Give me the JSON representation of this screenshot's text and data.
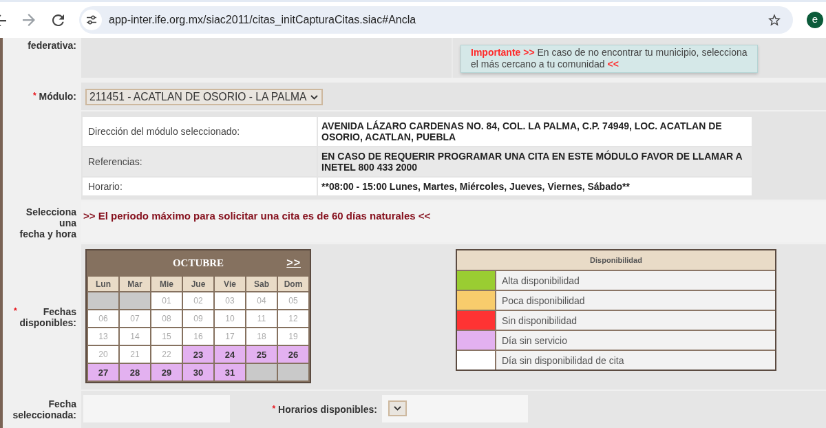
{
  "browser": {
    "url": "app-inter.ife.org.mx/siac2011/citas_initCapturaCitas.siac#Ancla",
    "profile_initial": "e"
  },
  "entity_row": {
    "label": "federativa:",
    "notice": "**Importante >>** En caso de no encontrar tu municipio, selecciona el más cercano a tu comunidad **<<**"
  },
  "module_row": {
    "required_mark": "*",
    "label": "Módulo:",
    "value": "211451 - ACATLAN DE OSORIO - LA PALMA"
  },
  "module_details": [
    {
      "label": "Dirección del módulo seleccionado:",
      "value": "AVENIDA LÁZARO CARDENAS NO. 84, COL. LA PALMA, C.P. 74949, LOC. ACATLAN DE OSORIO, ACATLAN, PUEBLA"
    },
    {
      "label": "Referencias:",
      "value": "EN CASO DE REQUERIR PROGRAMAR UNA CITA EN ESTE MÓDULO FAVOR DE LLAMAR A INETEL 800 433 2000"
    },
    {
      "label": "Horario:",
      "value": "**08:00 - 15:00 Lunes, Martes, Miércoles, Jueves, Viernes, Sábado**"
    }
  ],
  "date_time_row": {
    "label_lines": [
      "Selecciona",
      "una",
      "fecha y hora"
    ],
    "message": ">> El periodo máximo para solicitar una cita es de 60 días naturales <<"
  },
  "dates_row": {
    "required_mark": "*",
    "label_lines": [
      "Fechas",
      "disponibles:"
    ],
    "calendar": {
      "month": "OCTUBRE",
      "next_link": ">>",
      "weekdays": [
        "Lun",
        "Mar",
        "Mie",
        "Jue",
        "Vie",
        "Sab",
        "Dom"
      ],
      "weeks": [
        [
          {
            "kind": "blank"
          },
          {
            "kind": "blank"
          },
          {
            "kind": "no_appointment",
            "day": "01"
          },
          {
            "kind": "no_appointment",
            "day": "02"
          },
          {
            "kind": "no_appointment",
            "day": "03"
          },
          {
            "kind": "no_appointment",
            "day": "04"
          },
          {
            "kind": "no_appointment",
            "day": "05"
          }
        ],
        [
          {
            "kind": "no_appointment",
            "day": "06"
          },
          {
            "kind": "no_appointment",
            "day": "07"
          },
          {
            "kind": "no_appointment",
            "day": "08"
          },
          {
            "kind": "no_appointment",
            "day": "09"
          },
          {
            "kind": "no_appointment",
            "day": "10"
          },
          {
            "kind": "no_appointment",
            "day": "11"
          },
          {
            "kind": "no_appointment",
            "day": "12"
          }
        ],
        [
          {
            "kind": "no_appointment",
            "day": "13"
          },
          {
            "kind": "no_appointment",
            "day": "14"
          },
          {
            "kind": "no_appointment",
            "day": "15"
          },
          {
            "kind": "no_appointment",
            "day": "16"
          },
          {
            "kind": "no_appointment",
            "day": "17"
          },
          {
            "kind": "no_appointment",
            "day": "18"
          },
          {
            "kind": "no_appointment",
            "day": "19"
          }
        ],
        [
          {
            "kind": "no_appointment",
            "day": "20"
          },
          {
            "kind": "no_appointment",
            "day": "21"
          },
          {
            "kind": "no_appointment",
            "day": "22"
          },
          {
            "kind": "no_service",
            "day": "23"
          },
          {
            "kind": "no_service",
            "day": "24"
          },
          {
            "kind": "no_service",
            "day": "25"
          },
          {
            "kind": "no_service",
            "day": "26"
          }
        ],
        [
          {
            "kind": "no_service",
            "day": "27"
          },
          {
            "kind": "no_service",
            "day": "28"
          },
          {
            "kind": "no_service",
            "day": "29"
          },
          {
            "kind": "no_service",
            "day": "30"
          },
          {
            "kind": "no_service",
            "day": "31"
          },
          {
            "kind": "blank"
          },
          {
            "kind": "blank"
          }
        ]
      ]
    },
    "legend": {
      "title": "Disponibilidad",
      "items": [
        {
          "label": "Alta disponibilidad",
          "color": "#9acd32"
        },
        {
          "label": "Poca disponibilidad",
          "color": "#f8cc6c"
        },
        {
          "label": "Sin disponibilidad",
          "color": "#ff3333"
        },
        {
          "label": "Día sin servicio",
          "color": "#e3b1f0"
        },
        {
          "label": "Día sin disponibilidad de cita",
          "color": "#ffffff"
        }
      ]
    }
  },
  "selection_row": {
    "date_label_lines": [
      "Fecha",
      "seleccionada:"
    ],
    "time_required_mark": "*",
    "time_label": "Horarios disponibles:"
  }
}
